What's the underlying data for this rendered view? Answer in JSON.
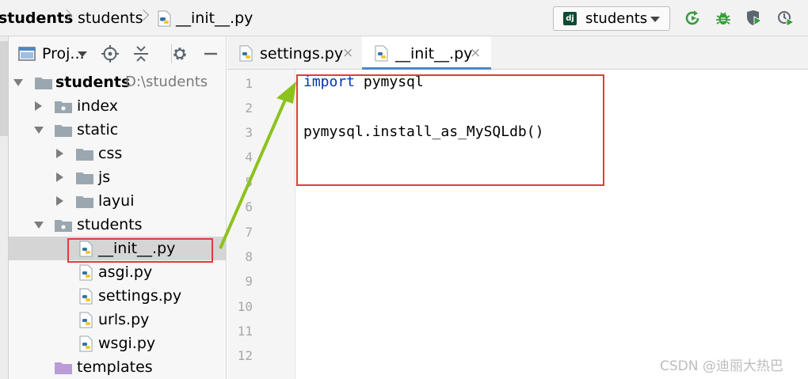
{
  "breadcrumb": {
    "items": [
      "students",
      "students",
      "__init__.py"
    ]
  },
  "toolbar": {
    "run_config_label": "students",
    "run_config_badge": "dj",
    "icons": [
      "rerun-icon",
      "debug-icon",
      "coverage-icon",
      "profile-icon"
    ]
  },
  "project_panel": {
    "title": "Proj...",
    "header_icons": [
      "target-icon",
      "collapse-all-icon",
      "gear-icon",
      "minimize-icon"
    ],
    "root": {
      "label": "students",
      "path": "D:\\students"
    },
    "items": [
      {
        "label": "index"
      },
      {
        "label": "static"
      },
      {
        "label": "css"
      },
      {
        "label": "js"
      },
      {
        "label": "layui"
      },
      {
        "label": "students"
      },
      {
        "label": "__init__.py"
      },
      {
        "label": "asgi.py"
      },
      {
        "label": "settings.py"
      },
      {
        "label": "urls.py"
      },
      {
        "label": "wsgi.py"
      },
      {
        "label": "templates"
      }
    ]
  },
  "tabs": [
    {
      "label": "settings.py",
      "close": "×"
    },
    {
      "label": "__init__.py",
      "close": "×"
    }
  ],
  "editor": {
    "line_numbers": [
      "1",
      "2",
      "3",
      "4",
      "5",
      "6",
      "7",
      "8",
      "9",
      "10",
      "11",
      "12"
    ],
    "code": {
      "line1_keyword": "import",
      "line1_rest": " pymysql",
      "line3": "pymysql.install_as_MySQLdb()"
    }
  },
  "colors": {
    "keyword": "#0033b3",
    "highlight_box": "#e03c3c",
    "arrow": "#8cc21c",
    "active_tab_underline": "#4a88c7"
  },
  "watermark": "CSDN @迪丽大热巴"
}
